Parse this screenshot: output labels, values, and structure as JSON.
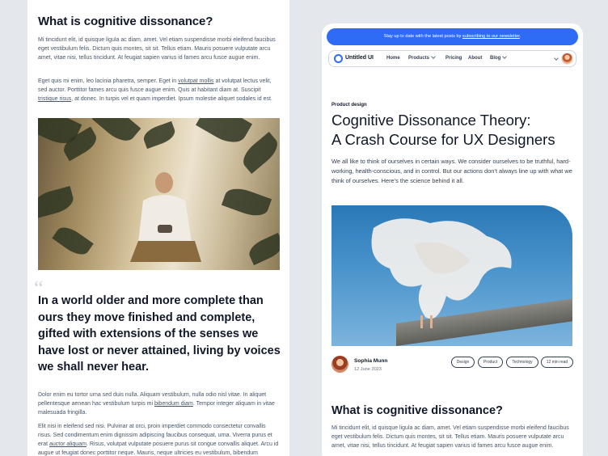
{
  "left": {
    "heading": "What is cognitive dissonance?",
    "p1": "Mi tincidunt elit, id quisque ligula ac diam, amet. Vel etiam suspendisse morbi eleifend faucibus eget vestibulum felis. Dictum quis montes, sit sit. Tellus etiam. Mauris posuere vulputate arcu amet, vitae nisi, tellus tincidunt. At feugiat sapien varius id fames arcu fusce augue enim.",
    "p2_a": "Eget quis mi enim, leo lacinia pharetra, semper. Eget in ",
    "p2_link1": "volutpat mollis",
    "p2_b": " at volutpat lectus velit, sed auctor. Porttitor fames arcu quis fusce augue enim. Quis at habitant diam at. Suscipit ",
    "p2_link2": "tristique risus",
    "p2_c": ", at donec. In turpis vel et quam imperdiet. Ipsum molestie aliquet sodales id est.",
    "quote_mark": "“",
    "quote": "In a world older and more complete than ours they move finished and complete, gifted with extensions of the senses we have lost or never attained, living by voices we shall never hear.",
    "p3_a": "Dolor enim eu tortor urna sed duis nulla. Aliquam vestibulum, nulla odio nisl vitae. In aliquet pellentesque aenean hac vestibulum turpis mi ",
    "p3_link": "bibendum diam",
    "p3_b": ". Tempor integer aliquam in vitae malesuada fringilla.",
    "p4_a": "Elit nisi in eleifend sed nisi. Pulvinar at orci, proin imperdiet commodo consectetur convallis risus. Sed condimentum enim dignissim adipiscing faucibus consequat, urna. Viverra purus et erat ",
    "p4_link": "auctor aliquam",
    "p4_b": ". Risus, volutpat vulputate posuere purus sit congue convallis aliquet. Arcu id augue ut feugiat donec porttitor neque. Mauris, neque ultricies eu vestibulum, bibendum"
  },
  "card": {
    "banner_text": "Stay up to date with the latest posts by ",
    "banner_link": "subscribing to our newsletter",
    "banner_end": ".",
    "brand": "Untitled UI",
    "nav": [
      "Home",
      "Products",
      "Pricing",
      "About",
      "Blog"
    ],
    "eyebrow": "Product design",
    "title_line1": "Cognitive Dissonance Theory:",
    "title_line2": "A Crash Course for UX Designers",
    "intro": "We all like to think of ourselves in certain ways. We consider ourselves to be truthful, hard-working, health-conscious, and in control. But our actions don’t always line up with what we think of ourselves. Here’s the science behind it all.",
    "author_name": "Sophia Munn",
    "author_date": "12 June 2023",
    "tags": [
      "Design",
      "Product",
      "Technology",
      "12 min read"
    ],
    "heading2": "What is cognitive dissonance?",
    "p1": "Mi tincidunt elit, id quisque ligula ac diam, amet. Vel etiam suspendisse morbi eleifend faucibus eget vestibulum felis. Dictum quis montes, sit sit. Tellus etiam. Mauris posuere vulputate arcu amet, vitae nisi, tellus tincidunt. At feugiat sapien varius id fames arcu fusce augue enim."
  },
  "colors": {
    "accent": "#2e6cf6",
    "background": "#e4e7ec",
    "text": "#101828"
  }
}
